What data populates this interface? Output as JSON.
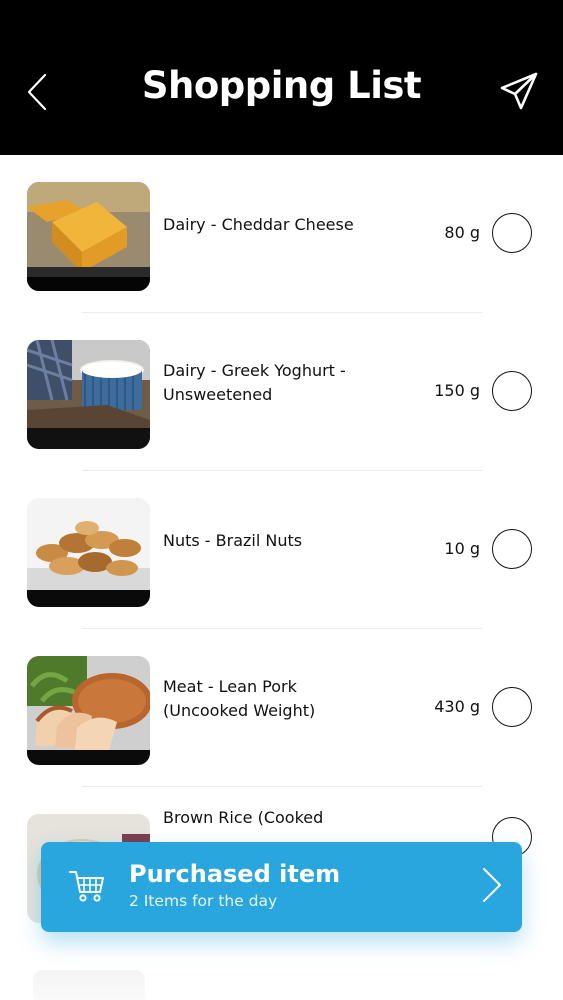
{
  "header": {
    "title": "Shopping List"
  },
  "items": [
    {
      "name": "Dairy - Cheddar Cheese",
      "quantity": "80 g"
    },
    {
      "name": "Dairy - Greek Yoghurt - Unsweetened",
      "quantity": "150 g"
    },
    {
      "name": "Nuts - Brazil Nuts",
      "quantity": "10 g"
    },
    {
      "name": "Meat - Lean Pork (Uncooked Weight)",
      "quantity": "430 g"
    },
    {
      "name": "Brown Rice (Cooked",
      "quantity": ""
    }
  ],
  "purchased": {
    "title": "Purchased item",
    "subtitle": "2 Items for the day"
  },
  "colors": {
    "header_bg": "#000000",
    "accent": "#2aa6de"
  },
  "icons": {
    "back": "chevron-left-icon",
    "send": "paper-plane-icon",
    "cart": "cart-icon",
    "forward": "chevron-right-icon"
  }
}
